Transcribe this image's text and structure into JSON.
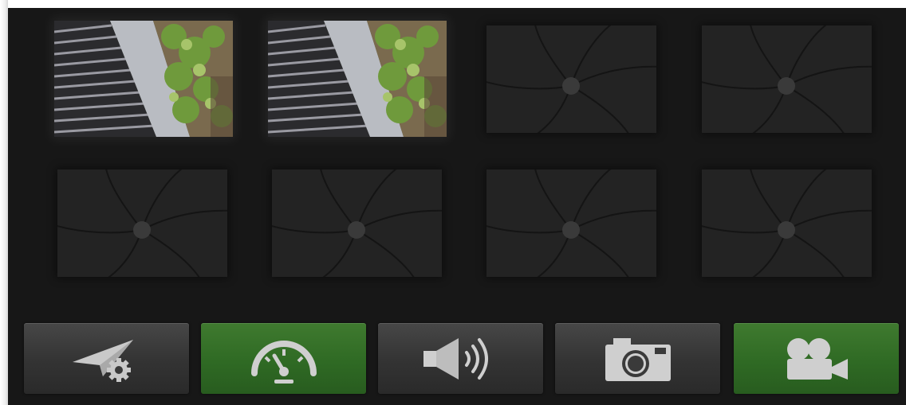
{
  "gallery": {
    "tiles": [
      {
        "state": "photo"
      },
      {
        "state": "photo"
      },
      {
        "state": "empty"
      },
      {
        "state": "empty"
      },
      {
        "state": "empty"
      },
      {
        "state": "empty"
      },
      {
        "state": "empty"
      },
      {
        "state": "empty"
      }
    ],
    "empty_icon": "camera-shutter-icon"
  },
  "toolbar": {
    "buttons": [
      {
        "icon": "send-settings-icon",
        "active": false
      },
      {
        "icon": "speedometer-icon",
        "active": true
      },
      {
        "icon": "speaker-volume-icon",
        "active": false
      },
      {
        "icon": "camera-icon",
        "active": false
      },
      {
        "icon": "video-camera-icon",
        "active": true
      }
    ]
  },
  "colors": {
    "background": "#171717",
    "tile": "#222222",
    "button": "#3a3a3a",
    "button_active": "#2f6a24",
    "icon": "#d2d2d2"
  }
}
